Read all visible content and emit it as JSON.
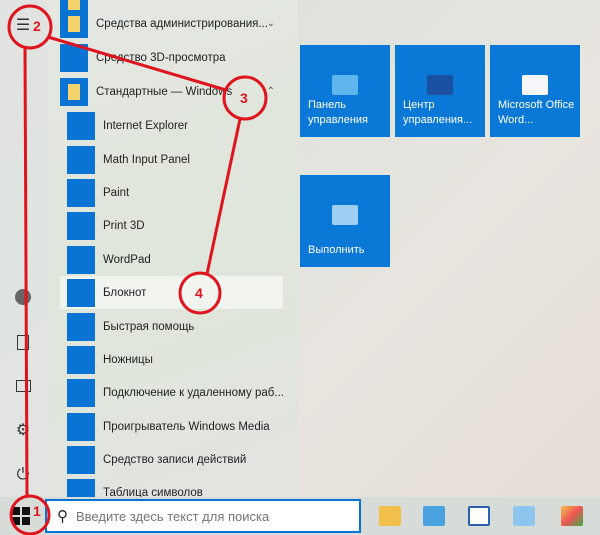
{
  "rail": {
    "items": [
      "menu-icon",
      "user-icon",
      "document-icon",
      "pictures-icon",
      "settings-icon",
      "power-icon"
    ]
  },
  "list": [
    {
      "label": "",
      "type": "folder"
    },
    {
      "label": "Средства администрирования...",
      "type": "folder",
      "chevron": "⌄"
    },
    {
      "label": "Средство 3D-просмотра",
      "type": "app"
    },
    {
      "label": "Стандартные — Windows",
      "type": "folder",
      "chevron": "⌃"
    },
    {
      "label": "Internet Explorer",
      "type": "sub"
    },
    {
      "label": "Math Input Panel",
      "type": "sub"
    },
    {
      "label": "Paint",
      "type": "sub"
    },
    {
      "label": "Print 3D",
      "type": "sub"
    },
    {
      "label": "WordPad",
      "type": "sub"
    },
    {
      "label": "Блокнот",
      "type": "sub",
      "highlighted": true
    },
    {
      "label": "Быстрая помощь",
      "type": "sub"
    },
    {
      "label": "Ножницы",
      "type": "sub"
    },
    {
      "label": "Подключение к удаленному раб...",
      "type": "sub"
    },
    {
      "label": "Проигрыватель Windows Media",
      "type": "sub"
    },
    {
      "label": "Средство записи действий",
      "type": "sub"
    },
    {
      "label": "Таблица символов",
      "type": "sub"
    }
  ],
  "tiles": [
    {
      "label": "Панель управления"
    },
    {
      "label": "Центр управления..."
    },
    {
      "label": "Microsoft Office Word..."
    },
    {
      "label": "Выполнить"
    }
  ],
  "taskbar": {
    "search_placeholder": "Введите здесь текст для поиска",
    "pinned": [
      "file-explorer-icon",
      "control-panel-icon",
      "word-icon",
      "run-icon",
      "paint-icon"
    ]
  },
  "annotations": [
    "1",
    "2",
    "3",
    "4"
  ],
  "colors": {
    "accent": "#0a78d6",
    "annotation": "#e0141e"
  }
}
